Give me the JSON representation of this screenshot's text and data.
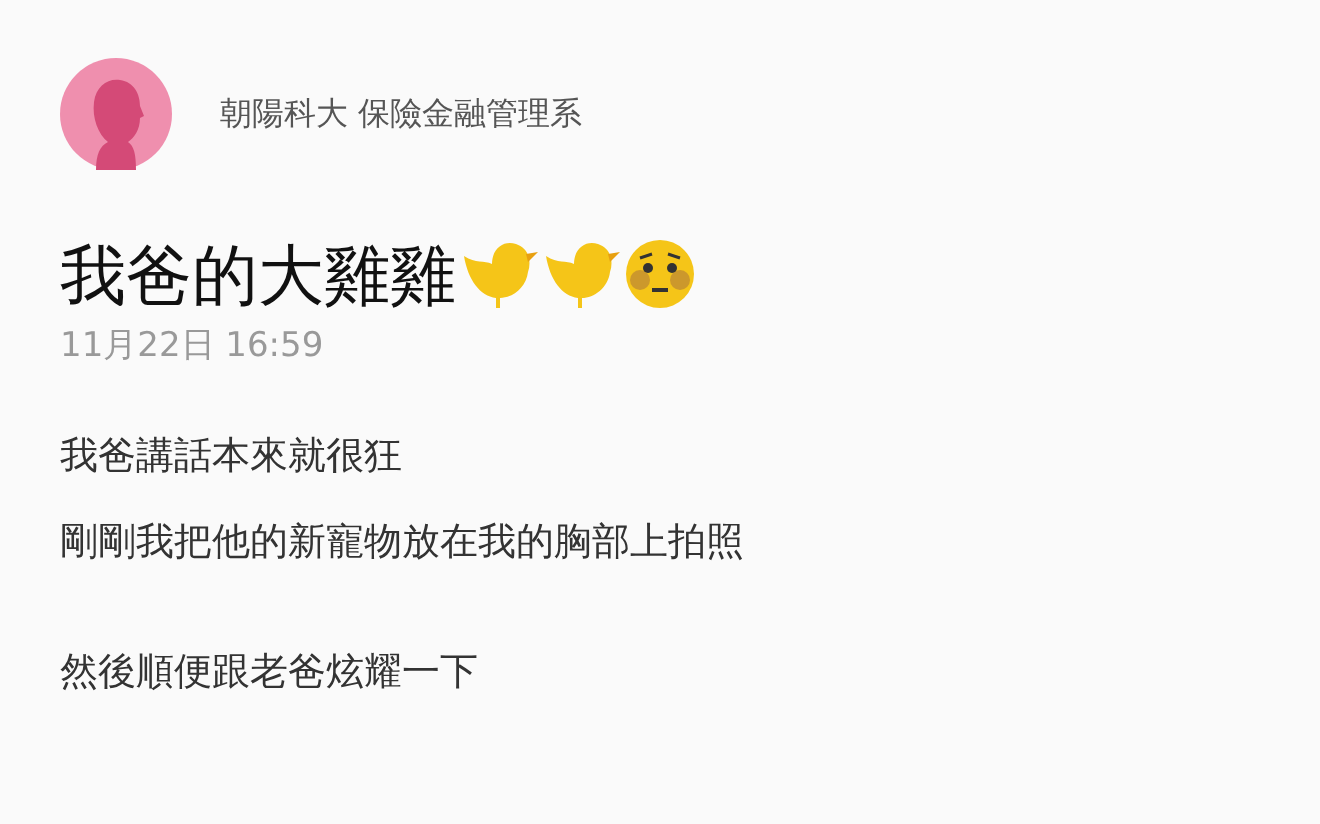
{
  "author": {
    "school": "朝陽科大 保險金融管理系"
  },
  "post": {
    "title": "我爸的大雞雞",
    "title_emoji": [
      {
        "kind": "chick"
      },
      {
        "kind": "chick"
      },
      {
        "kind": "worried_face"
      }
    ],
    "date": "11月22日 16:59",
    "paragraphs": [
      [
        "我爸講話本來就很狂",
        "剛剛我把他的新寵物放在我的胸部上拍照"
      ],
      [
        "然後順便跟老爸炫耀一下"
      ]
    ]
  }
}
